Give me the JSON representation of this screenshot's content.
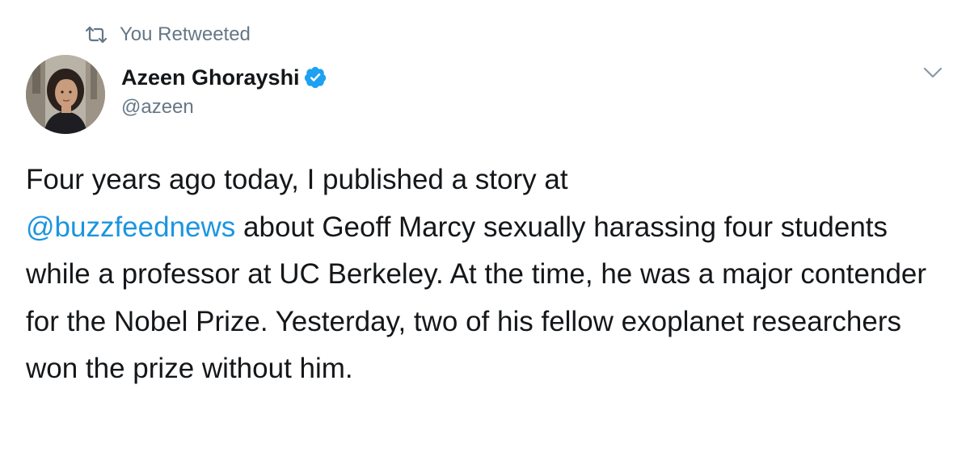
{
  "retweet": {
    "icon": "retweet-icon",
    "label": "You Retweeted"
  },
  "author": {
    "avatar_icon": "avatar-photo",
    "display_name": "Azeen Ghorayshi",
    "verified_icon": "verified-badge-icon",
    "handle": "@azeen"
  },
  "menu": {
    "icon": "chevron-down-icon"
  },
  "tweet": {
    "text_part_1": "Four years ago today, I published a story at",
    "mention": "@buzzfeednews",
    "text_part_2": " about Geoff Marcy sexually harassing four students while a professor at UC Berkeley. At the time, he was a major contender for the Nobel Prize. Yesterday, two of his fellow exoplanet researchers won the prize without him."
  },
  "colors": {
    "text": "#14171a",
    "secondary": "#657786",
    "link": "#1b95e0",
    "verified": "#1da1f2"
  }
}
